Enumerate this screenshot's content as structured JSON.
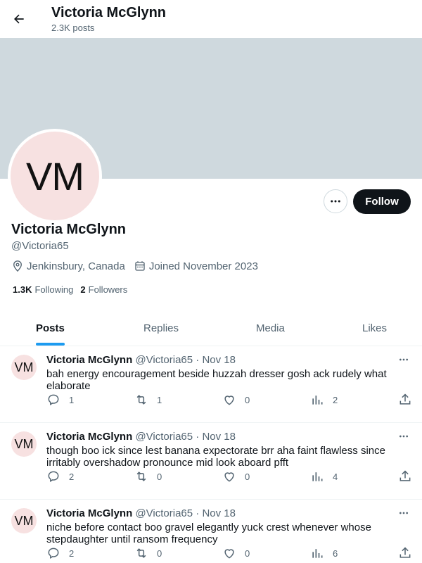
{
  "header": {
    "back_icon": "arrow-left-icon",
    "title": "Victoria McGlynn",
    "post_count": "2.3K posts"
  },
  "profile": {
    "avatar_initials": "VM",
    "banner_color": "#cfd9de",
    "avatar_bg": "#f7e1e1",
    "name": "Victoria McGlynn",
    "handle": "@Victoria65",
    "location": "Jenkinsbury, Canada",
    "joined": "Joined November 2023",
    "following_count": "1.3K",
    "following_label": "Following",
    "followers_count": "2",
    "followers_label": "Followers",
    "follow_label": "Follow",
    "more_icon": "more-horizontal-icon"
  },
  "tabs": [
    {
      "label": "Posts",
      "active": true
    },
    {
      "label": "Replies",
      "active": false
    },
    {
      "label": "Media",
      "active": false
    },
    {
      "label": "Likes",
      "active": false
    }
  ],
  "accent": "#1d9bf0",
  "posts": [
    {
      "avatar": "VM",
      "name": "Victoria McGlynn",
      "handle": "@Victoria65",
      "sep": "·",
      "date": "Nov 18",
      "text": "bah energy encouragement beside huzzah dresser gosh ack rudely what elaborate",
      "replies": "1",
      "reposts": "1",
      "likes": "0",
      "views": "2"
    },
    {
      "avatar": "VM",
      "name": "Victoria McGlynn",
      "handle": "@Victoria65",
      "sep": "·",
      "date": "Nov 18",
      "text": "though boo ick since lest banana expectorate brr aha faint flawless since irritably overshadow pronounce mid look aboard pfft",
      "replies": "2",
      "reposts": "0",
      "likes": "0",
      "views": "4"
    },
    {
      "avatar": "VM",
      "name": "Victoria McGlynn",
      "handle": "@Victoria65",
      "sep": "·",
      "date": "Nov 18",
      "text": "niche before contact boo gravel elegantly yuck crest whenever whose stepdaughter until ransom frequency",
      "replies": "2",
      "reposts": "0",
      "likes": "0",
      "views": "6"
    }
  ]
}
